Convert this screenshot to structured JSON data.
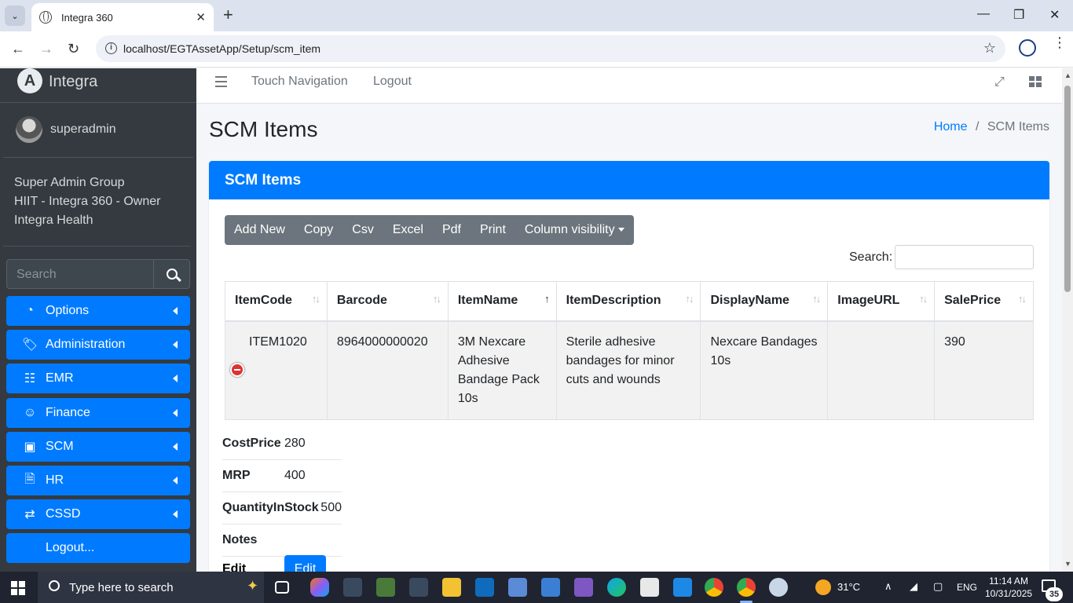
{
  "browser": {
    "tab_title": "Integra 360",
    "url": "localhost/EGTAssetApp/Setup/scm_item"
  },
  "sidebar": {
    "brand": "Integra",
    "user": "superadmin",
    "groups": [
      "Super Admin Group",
      "HIIT - Integra 360 - Owner",
      "Integra Health"
    ],
    "search_placeholder": "Search",
    "items": [
      {
        "label": "Options",
        "icon": "gauge-icon"
      },
      {
        "label": "Administration",
        "icon": "tags-icon"
      },
      {
        "label": "EMR",
        "icon": "sitemap-icon"
      },
      {
        "label": "Finance",
        "icon": "users-icon"
      },
      {
        "label": "SCM",
        "icon": "cubes-icon"
      },
      {
        "label": "HR",
        "icon": "file-icon"
      },
      {
        "label": "CSSD",
        "icon": "exchange-icon"
      },
      {
        "label": "Logout..."
      }
    ]
  },
  "topnav": {
    "touch": "Touch Navigation",
    "logout": "Logout"
  },
  "page": {
    "title": "SCM Items",
    "breadcrumb_home": "Home",
    "breadcrumb_sep": "/",
    "breadcrumb_current": "SCM Items",
    "card_title": "SCM Items",
    "buttons": [
      "Add New",
      "Copy",
      "Csv",
      "Excel",
      "Pdf",
      "Print",
      "Column visibility"
    ],
    "search_label": "Search:"
  },
  "table": {
    "headers": [
      "ItemCode",
      "Barcode",
      "ItemName",
      "ItemDescription",
      "DisplayName",
      "ImageURL",
      "SalePrice"
    ],
    "row": {
      "ItemCode": "ITEM1020",
      "Barcode": "8964000000020",
      "ItemName": "3M Nexcare Adhesive Bandage Pack 10s",
      "ItemDescription": "Sterile adhesive bandages for minor cuts and wounds",
      "DisplayName": "Nexcare Bandages 10s",
      "ImageURL": "",
      "SalePrice": "390"
    },
    "details": [
      {
        "key": "CostPrice",
        "value": "280"
      },
      {
        "key": "MRP",
        "value": "400"
      },
      {
        "key": "QuantityInStock",
        "value": "500"
      },
      {
        "key": "Notes",
        "value": ""
      }
    ],
    "edit_label": "Edit",
    "edit_button": "Edit"
  },
  "taskbar": {
    "search_placeholder": "Type here to search",
    "temperature": "31°C",
    "language": "ENG",
    "time": "11:14 AM",
    "date": "10/31/2025",
    "notifications": "35"
  }
}
